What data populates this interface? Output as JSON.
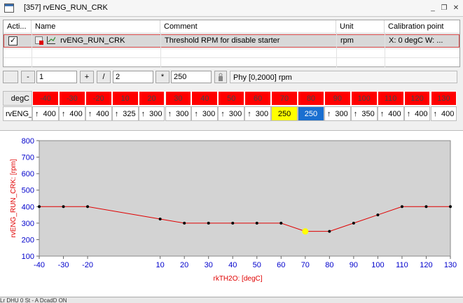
{
  "window": {
    "title": "[357] rvENG_RUN_CRK",
    "min_glyph": "_",
    "restore_glyph": "❐",
    "close_glyph": "✕"
  },
  "list": {
    "headers": [
      "Acti...",
      "Name",
      "Comment",
      "Unit",
      "Calibration point"
    ],
    "row": {
      "checked": true,
      "name": "rvENG_RUN_CRK",
      "comment": "Threshold RPM for disable starter",
      "unit": "rpm",
      "calibration": "X:  0 degC  W: ..."
    }
  },
  "toolbar": {
    "minus_label": "-",
    "value1": "1",
    "plus_label": "+",
    "div_label": "/",
    "value2": "2",
    "mul_label": "*",
    "value3": "250",
    "phys_label": "Phy [0,2000]  rpm"
  },
  "table": {
    "x_axis_label": "degC",
    "row_label": "rvENG_",
    "arrow": "↑"
  },
  "chart_data": {
    "type": "line",
    "x": [
      -40,
      -30,
      -20,
      10,
      20,
      30,
      40,
      50,
      60,
      70,
      80,
      90,
      100,
      110,
      120,
      130
    ],
    "values": [
      400,
      400,
      400,
      325,
      300,
      300,
      300,
      300,
      300,
      250,
      250,
      300,
      350,
      400,
      400,
      400
    ],
    "selected_index": 9,
    "highlighted_index": 10,
    "ylabel": "rvENG_RUN_CRK: [rpm]",
    "xlabel": "rkTH2O: [degC]",
    "xlim": [
      -40,
      130
    ],
    "ylim": [
      100,
      800
    ],
    "xticks": [
      -40,
      -30,
      -20,
      10,
      20,
      30,
      40,
      50,
      60,
      70,
      80,
      90,
      100,
      110,
      120,
      130
    ],
    "yticks": [
      100,
      200,
      300,
      400,
      500,
      600,
      700,
      800
    ],
    "colors": {
      "line": "#e00000",
      "marker": "#000000",
      "selected": "#ffff00",
      "selected_cell": "#ffff00",
      "highlight_cell": "#1a6fd0",
      "header": "#ff0000",
      "axis_text": "#0000cc",
      "plot_bg": "#d3d3d3"
    }
  },
  "status": {
    "text": "Lr  DHU 0  St - A  DcadD          ON"
  }
}
